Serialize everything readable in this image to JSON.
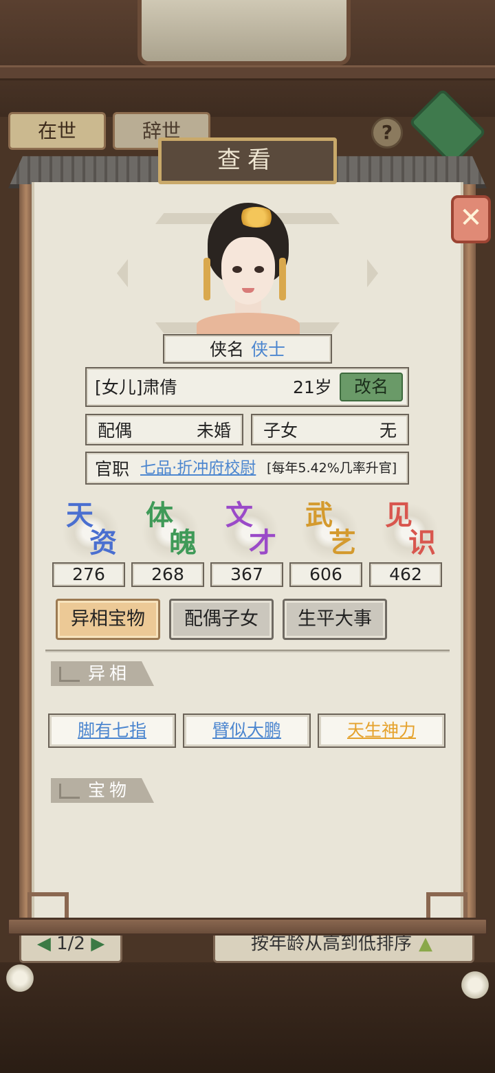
{
  "background": {
    "tabs": [
      "在世",
      "辞世"
    ],
    "help_icon": "?",
    "pager": {
      "text": "1/2"
    },
    "sort_label": "按年龄从高到低排序"
  },
  "dialog": {
    "title": "查看",
    "close_icon": "close-icon"
  },
  "profile": {
    "name_label": "侠名",
    "name_value": "侠士",
    "identity": "[女儿]肃倩",
    "age": "21岁",
    "rename_label": "改名",
    "spouse_label": "配偶",
    "spouse_value": "未婚",
    "children_label": "子女",
    "children_value": "无",
    "office_label": "官职",
    "office_value": "七品·折冲府校尉",
    "office_note": "[每年5.42%几率升官]"
  },
  "stats": [
    {
      "label_1": "天",
      "label_2": "资",
      "value": "276",
      "color": "#4a6fd0"
    },
    {
      "label_1": "体",
      "label_2": "魄",
      "value": "268",
      "color": "#3f9a58"
    },
    {
      "label_1": "文",
      "label_2": "才",
      "value": "367",
      "color": "#9a4ac8"
    },
    {
      "label_1": "武",
      "label_2": "艺",
      "value": "606",
      "color": "#d49a2e"
    },
    {
      "label_1": "见",
      "label_2": "识",
      "value": "462",
      "color": "#d8564e"
    }
  ],
  "tabs": [
    {
      "label": "异相宝物",
      "active": true
    },
    {
      "label": "配偶子女",
      "active": false
    },
    {
      "label": "生平大事",
      "active": false
    }
  ],
  "sections": {
    "traits_title": "异相",
    "treasures_title": "宝物"
  },
  "traits": [
    {
      "label": "脚有七指",
      "color": "#4c86cf"
    },
    {
      "label": "臂似大鹏",
      "color": "#4c86cf"
    },
    {
      "label": "天生神力",
      "color": "#e5a22c"
    }
  ],
  "colors": {
    "link_blue": "#4c86cf",
    "active_tab": "#ecc996",
    "rename_green": "#6a9a68",
    "close_red": "#e08a76"
  }
}
